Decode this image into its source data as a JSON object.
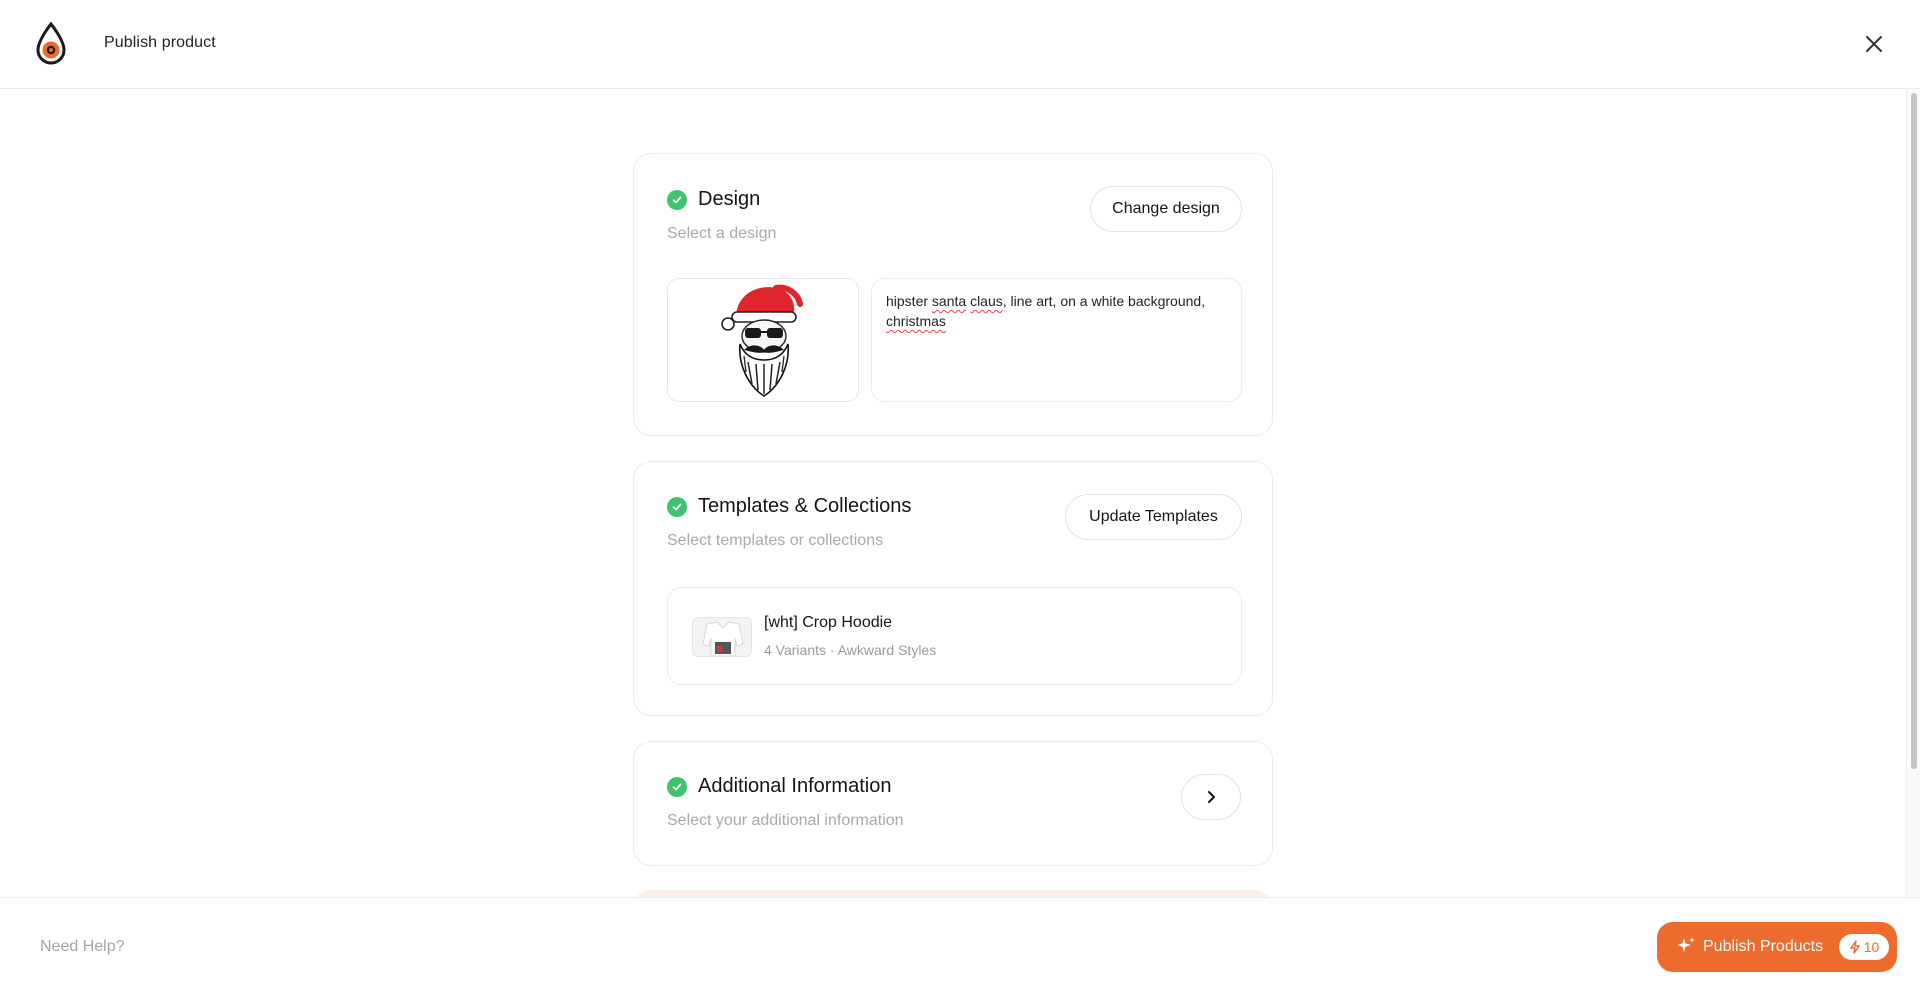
{
  "header": {
    "title": "Publish product",
    "logo_icon": "droplet-logo-icon",
    "close_icon": "close-icon"
  },
  "design_card": {
    "title": "Design",
    "subtitle": "Select a design",
    "action_label": "Change design",
    "image_alt": "santa-claus-design-icon",
    "prompt": {
      "part1": "hipster ",
      "word1": "santa",
      "space1": " ",
      "word2": "claus",
      "part2": ", line art, on a white background, ",
      "word3": "christmas"
    }
  },
  "templates_card": {
    "title": "Templates & Collections",
    "subtitle": "Select templates or collections",
    "action_label": "Update Templates",
    "items": [
      {
        "name": "[wht] Crop Hoodie",
        "meta": "4 Variants · Awkward Styles"
      }
    ]
  },
  "additional_card": {
    "title": "Additional Information",
    "subtitle": "Select your additional information"
  },
  "footer": {
    "help_label": "Need Help?",
    "publish_label": "Publish Products",
    "credits": "10"
  },
  "colors": {
    "accent": "#ec6b2d",
    "success": "#3ec46d",
    "muted_text": "#a9a9a9"
  }
}
